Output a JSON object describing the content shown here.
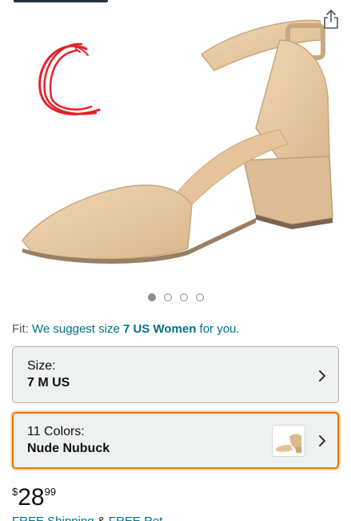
{
  "gallery": {
    "icons": {
      "share": "share-icon",
      "annotation": "red-handwritten-c"
    },
    "image_description": "beige block heel ankle strap pump",
    "dots_total": 4,
    "active_dot": 1
  },
  "fit": {
    "prefix": "Fit:",
    "link_text": "We suggest size",
    "size": "7 US Women",
    "suffix": "for you."
  },
  "size_selector": {
    "label": "Size:",
    "value": "7 M US",
    "icon": "chevron-right-icon"
  },
  "color_selector": {
    "label": "11 Colors:",
    "value": "Nude Nubuck",
    "icon": "chevron-right-icon"
  },
  "price": {
    "symbol": "$",
    "whole": "28",
    "fraction": "99"
  },
  "shipping": {
    "free_shipping": "FREE Shipping",
    "amp": "&",
    "free_returns": "FREE Ret"
  },
  "colors": {
    "link": "#007185",
    "accent_border": "#e77600",
    "shoe": "#e8c9a2",
    "annotation": "#e8202a"
  }
}
